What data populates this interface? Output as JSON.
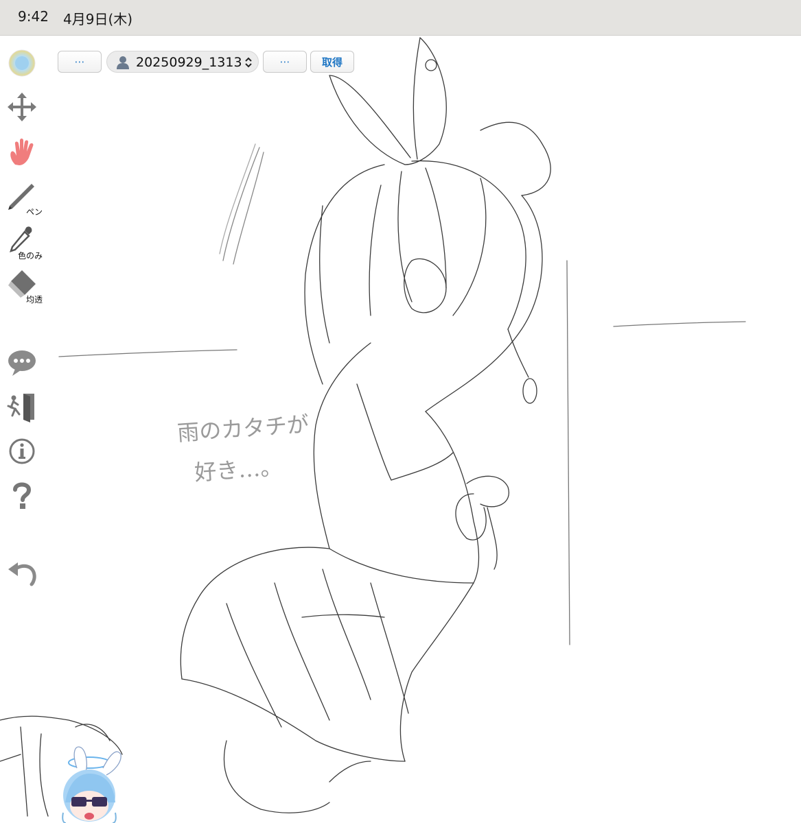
{
  "status_bar": {
    "time": "9:42",
    "date": "4月9日(木)"
  },
  "toolbar": {
    "prev_label": "⋯",
    "next_label": "⋯",
    "get_label": "取得",
    "user_selector": {
      "value": "20250929_1313",
      "icon": "person-icon"
    }
  },
  "tools": [
    {
      "name": "color-wheel",
      "label": ""
    },
    {
      "name": "move",
      "label": ""
    },
    {
      "name": "hand",
      "label": ""
    },
    {
      "name": "pen",
      "label": "ペン"
    },
    {
      "name": "dropper",
      "label": "色のみ"
    },
    {
      "name": "eraser",
      "label": "均透"
    },
    {
      "name": "chat",
      "label": ""
    },
    {
      "name": "exit",
      "label": ""
    },
    {
      "name": "info",
      "label": ""
    },
    {
      "name": "help",
      "label": ""
    },
    {
      "name": "undo",
      "label": ""
    }
  ],
  "drawing": {
    "handwritten_line1": "雨のカタチが",
    "handwritten_line2": "好き…。"
  },
  "colors": {
    "hand_tool": "#f07d7d",
    "tool_gray": "#8a8a8a",
    "accent_blue": "#1f76c4"
  }
}
